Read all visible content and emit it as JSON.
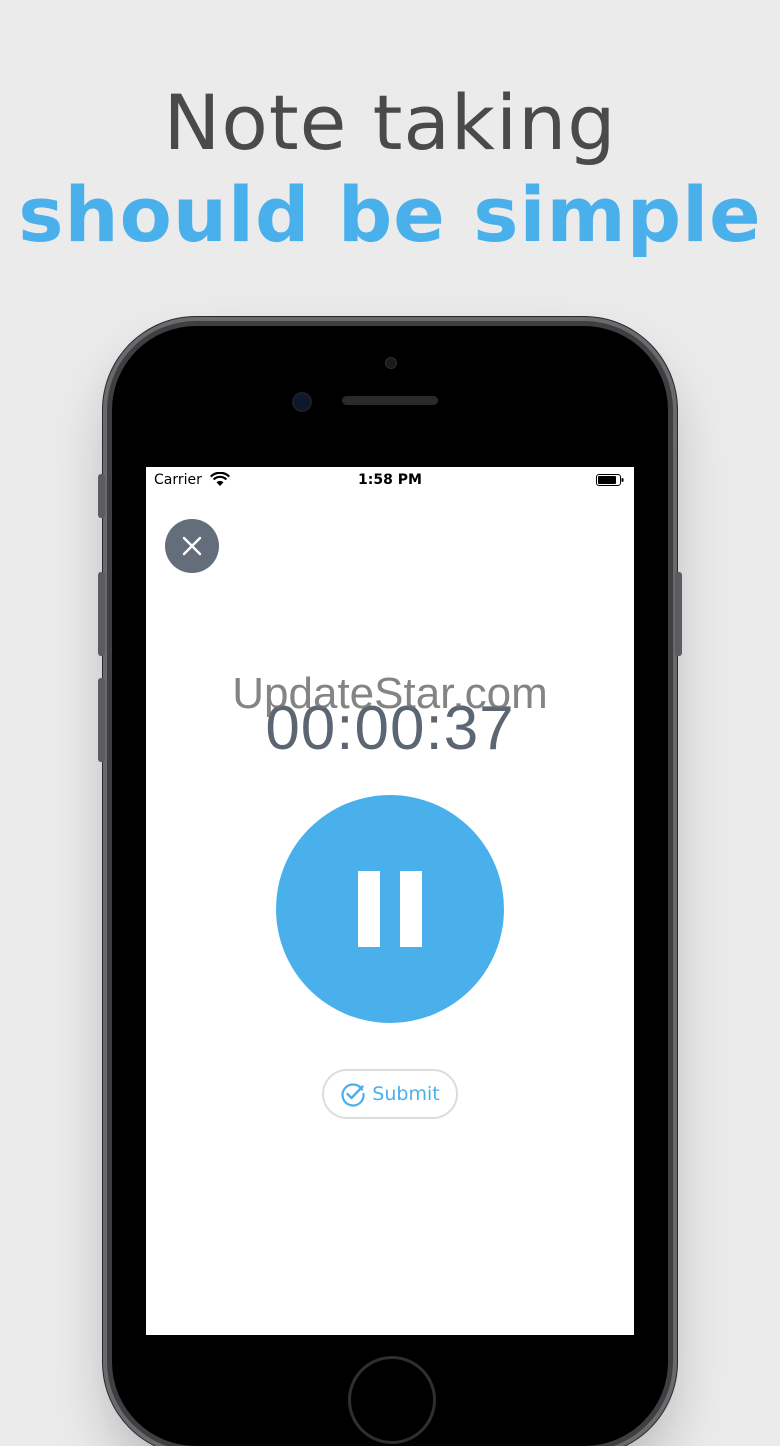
{
  "headline": {
    "line1": "Note taking",
    "line2": "should be simple"
  },
  "status_bar": {
    "carrier": "Carrier",
    "time": "1:58 PM",
    "icons": [
      "wifi-icon",
      "battery-icon"
    ]
  },
  "recorder": {
    "elapsed": "00:00:37",
    "close_icon": "close-icon",
    "pause_icon": "pause-icon",
    "submit_label": "Submit",
    "submit_icon": "check-circle-icon"
  },
  "watermark": "UpdateStar.com",
  "colors": {
    "accent": "#4ab0ec",
    "headline_dark": "#4a4a4a",
    "timer": "#5b6672",
    "close_bg": "#646e7a",
    "background": "#ebebeb"
  }
}
